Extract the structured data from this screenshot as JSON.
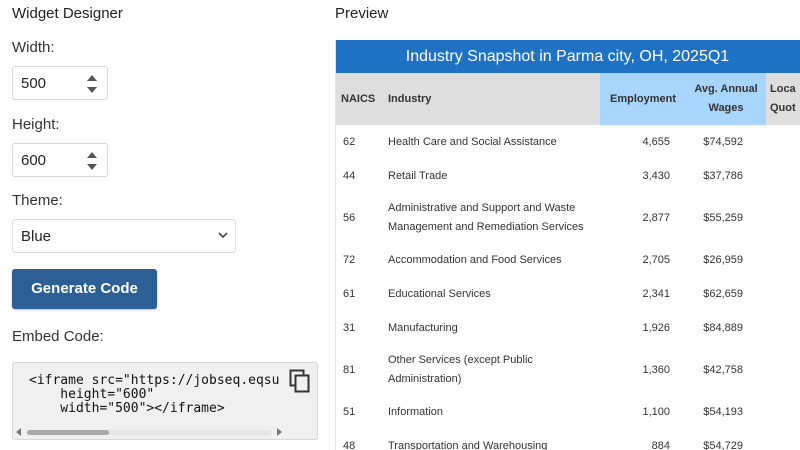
{
  "designer": {
    "title": "Widget Designer",
    "width_label": "Width:",
    "width_value": "500",
    "height_label": "Height:",
    "height_value": "600",
    "theme_label": "Theme:",
    "theme_value": "Blue",
    "generate_button": "Generate Code",
    "embed_label": "Embed Code:",
    "embed_code": "<iframe src=\"https://jobseq.eqsu\n    height=\"600\"\n    width=\"500\"></iframe>"
  },
  "preview": {
    "label": "Preview",
    "widget_title": "Industry Snapshot in Parma city, OH, 2025Q1",
    "accent_color": "#1f72c3",
    "highlight_color": "#a8d5fb",
    "columns": {
      "naics": "NAICS",
      "industry": "Industry",
      "employment": "Employment",
      "wages_line1": "Avg. Annual",
      "wages_line2": "Wages",
      "lq_line1": "Loca",
      "lq_line2": "Quot"
    },
    "rows": [
      {
        "naics": "62",
        "industry": "Health Care and Social Assistance",
        "employment": "4,655",
        "wages": "$74,592"
      },
      {
        "naics": "44",
        "industry": "Retail Trade",
        "employment": "3,430",
        "wages": "$37,786"
      },
      {
        "naics": "56",
        "industry": "Administrative and Support and Waste Management and Remediation Services",
        "employment": "2,877",
        "wages": "$55,259"
      },
      {
        "naics": "72",
        "industry": "Accommodation and Food Services",
        "employment": "2,705",
        "wages": "$26,959"
      },
      {
        "naics": "61",
        "industry": "Educational Services",
        "employment": "2,341",
        "wages": "$62,659"
      },
      {
        "naics": "31",
        "industry": "Manufacturing",
        "employment": "1,926",
        "wages": "$84,889"
      },
      {
        "naics": "81",
        "industry": "Other Services (except Public Administration)",
        "employment": "1,360",
        "wages": "$42,758"
      },
      {
        "naics": "51",
        "industry": "Information",
        "employment": "1,100",
        "wages": "$54,193"
      },
      {
        "naics": "48",
        "industry": "Transportation and Warehousing",
        "employment": "884",
        "wages": "$54,729"
      }
    ]
  }
}
